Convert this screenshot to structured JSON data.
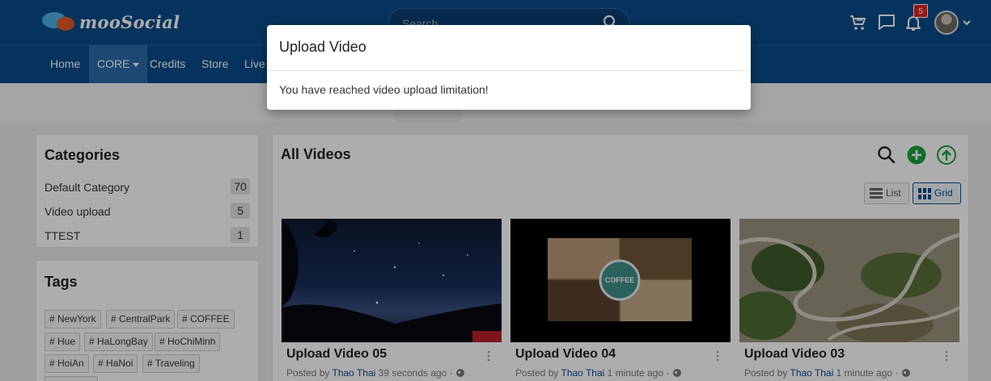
{
  "header": {
    "logo_text": "mooSocial",
    "search_placeholder": "Search",
    "notification_count": "5"
  },
  "nav": {
    "items": [
      {
        "label": "Home"
      },
      {
        "label": "CORE"
      },
      {
        "label": "Credits"
      },
      {
        "label": "Store"
      },
      {
        "label": "Live"
      }
    ]
  },
  "sidebar": {
    "categories_title": "Categories",
    "categories": [
      {
        "name": "Default Category",
        "count": "70"
      },
      {
        "name": "Video upload",
        "count": "5"
      },
      {
        "name": "TTEST",
        "count": "1"
      }
    ],
    "tags_title": "Tags",
    "tags": [
      "# NewYork",
      "# CentralPark",
      "# COFFEE",
      "# Hue",
      "# HaLongBay",
      "# HoChiMinh",
      "# HoiAn",
      "# HaNoi",
      "# Traveling"
    ]
  },
  "main": {
    "title": "All Videos",
    "view_list_label": "List",
    "view_grid_label": "Grid",
    "posted_by_label": "Posted by",
    "videos": [
      {
        "title": "Upload Video 05",
        "author": "Thao Thai",
        "time": "39 seconds ago ·"
      },
      {
        "title": "Upload Video 04",
        "author": "Thao Thai",
        "time": "1 minute ago ·"
      },
      {
        "title": "Upload Video 03",
        "author": "Thao Thai",
        "time": "1 minute ago ·"
      }
    ],
    "thumb2_text": "COFFEE"
  },
  "modal": {
    "title": "Upload Video",
    "message": "You have reached video upload limitation!"
  },
  "colors": {
    "header_bg": "#0a4c8a",
    "accent_green": "#1aa33b"
  }
}
